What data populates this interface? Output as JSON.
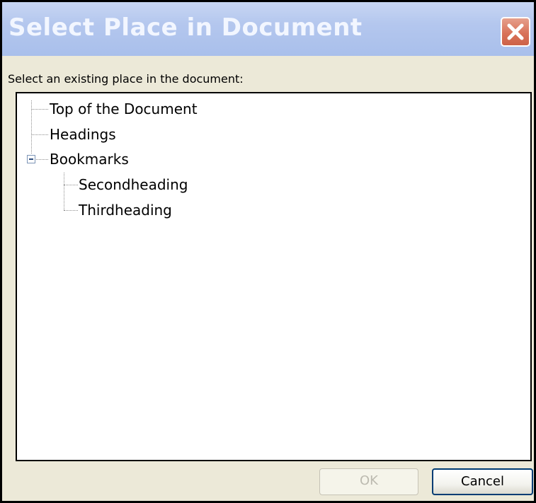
{
  "window": {
    "title": "Select Place in Document"
  },
  "instruction": "Select an existing place in the document:",
  "tree": {
    "items": [
      {
        "label": "Top of the Document"
      },
      {
        "label": "Headings"
      },
      {
        "label": "Bookmarks",
        "expanded": true,
        "children": [
          {
            "label": "Secondheading"
          },
          {
            "label": "Thirdheading"
          }
        ]
      }
    ]
  },
  "buttons": {
    "ok_label": "OK",
    "ok_enabled": false,
    "cancel_label": "Cancel"
  },
  "icons": {
    "close": "close-icon",
    "expander": "tree-collapse-icon"
  },
  "colors": {
    "titlebar": "#b4c7ee",
    "close_button": "#d9735a",
    "dialog_face": "#ece9d8",
    "default_button_border": "#003c74"
  }
}
